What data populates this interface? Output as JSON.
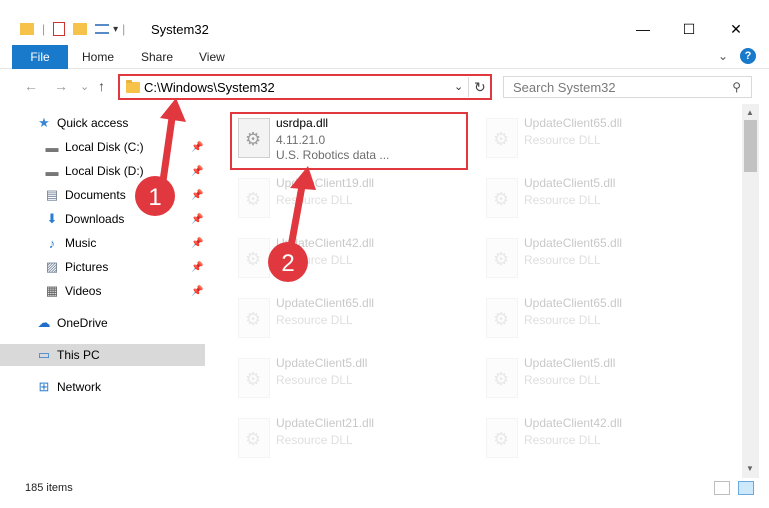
{
  "window": {
    "title": "System32",
    "minimize": "—",
    "maximize": "☐",
    "close": "✕"
  },
  "quick_access_toolbar": {
    "separator": "|",
    "customize": "▾"
  },
  "ribbon": {
    "tabs": [
      "File",
      "Home",
      "Share",
      "View"
    ],
    "expand": "⌄",
    "help": "?"
  },
  "nav": {
    "back": "←",
    "forward": "→",
    "recent": "⌄",
    "up": "↑"
  },
  "address_bar": {
    "path": "C:\\Windows\\System32",
    "dropdown": "⌄",
    "refresh": "↻"
  },
  "search": {
    "placeholder": "Search System32",
    "icon": "⚲"
  },
  "sidebar": {
    "items": [
      {
        "label": "Quick access",
        "icon": "star-icon",
        "glyph": "★",
        "pinned": false
      },
      {
        "label": "Local Disk (C:)",
        "icon": "drive-icon",
        "glyph": "▬",
        "pinned": true
      },
      {
        "label": "Local Disk (D:)",
        "icon": "drive-icon",
        "glyph": "▬",
        "pinned": true
      },
      {
        "label": "Documents",
        "icon": "documents-icon",
        "glyph": "▤",
        "pinned": true
      },
      {
        "label": "Downloads",
        "icon": "download-icon",
        "glyph": "⬇",
        "pinned": true
      },
      {
        "label": "Music",
        "icon": "music-icon",
        "glyph": "♪",
        "pinned": true
      },
      {
        "label": "Pictures",
        "icon": "pictures-icon",
        "glyph": "▨",
        "pinned": true
      },
      {
        "label": "Videos",
        "icon": "videos-icon",
        "glyph": "▦",
        "pinned": true
      },
      {
        "label": "OneDrive",
        "icon": "cloud-icon",
        "glyph": "☁",
        "pinned": false
      },
      {
        "label": "This PC",
        "icon": "computer-icon",
        "glyph": "▭",
        "pinned": false,
        "selected": true
      },
      {
        "label": "Network",
        "icon": "network-icon",
        "glyph": "⊞",
        "pinned": false
      }
    ],
    "pin_glyph": "📌"
  },
  "files": [
    {
      "name": "usrdpa.dll",
      "line2": "4.11.21.0",
      "line3": "U.S. Robotics data ...",
      "highlighted": true
    },
    {
      "name": "UpdateClient65.dll",
      "line2": "Resource DLL",
      "line3": ""
    },
    {
      "name": "UpdateClient19.dll",
      "line2": "Resource DLL",
      "line3": ""
    },
    {
      "name": "UpdateClient5.dll",
      "line2": "Resource DLL",
      "line3": ""
    },
    {
      "name": "UpdateClient42.dll",
      "line2": "Resource DLL",
      "line3": ""
    },
    {
      "name": "UpdateClient65.dll",
      "line2": "Resource DLL",
      "line3": ""
    },
    {
      "name": "UpdateClient65.dll",
      "line2": "Resource DLL",
      "line3": ""
    },
    {
      "name": "UpdateClient65.dll",
      "line2": "Resource DLL",
      "line3": ""
    },
    {
      "name": "UpdateClient5.dll",
      "line2": "Resource DLL",
      "line3": ""
    },
    {
      "name": "UpdateClient5.dll",
      "line2": "Resource DLL",
      "line3": ""
    },
    {
      "name": "UpdateClient21.dll",
      "line2": "Resource DLL",
      "line3": ""
    },
    {
      "name": "UpdateClient42.dll",
      "line2": "Resource DLL",
      "line3": ""
    },
    {
      "name": "",
      "line2": "",
      "line3": ""
    },
    {
      "name": "",
      "line2": "",
      "line3": ""
    }
  ],
  "status_bar": {
    "item_count": "185 items"
  },
  "annotations": {
    "step1": "1",
    "step2": "2",
    "color": "#e0383e"
  }
}
